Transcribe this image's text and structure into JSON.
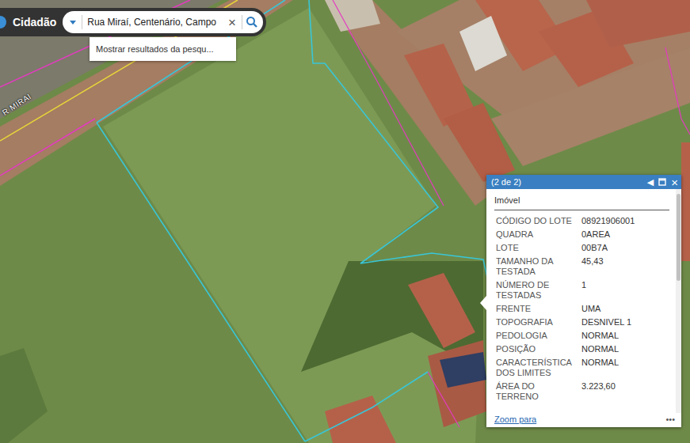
{
  "app": {
    "title": "Cidadão"
  },
  "search": {
    "value": "Rua Miraí, Centenário, Campo",
    "clear": "×",
    "suggestion": "Mostrar resultados da pesqu..."
  },
  "map": {
    "street_label": "R MIRAI"
  },
  "popup": {
    "pager": "(2 de 2)",
    "prev": "◀",
    "close": "×",
    "title": "Imóvel",
    "fields": [
      {
        "label": "CÓDIGO DO LOTE",
        "value": "08921906001"
      },
      {
        "label": "QUADRA",
        "value": "0AREA"
      },
      {
        "label": "LOTE",
        "value": "00B7A"
      },
      {
        "label": "TAMANHO DA TESTADA",
        "value": "45,43"
      },
      {
        "label": "NÚMERO DE TESTADAS",
        "value": "1"
      },
      {
        "label": "FRENTE",
        "value": "UMA"
      },
      {
        "label": "TOPOGRAFIA",
        "value": "DESNIVEL 1"
      },
      {
        "label": "PEDOLOGIA",
        "value": "NORMAL"
      },
      {
        "label": "POSIÇÃO",
        "value": "NORMAL"
      },
      {
        "label": "CARACTERÍSTICA DOS LIMITES",
        "value": "NORMAL"
      },
      {
        "label": "ÁREA DO TERRENO",
        "value": "3.223,60"
      }
    ],
    "zoom_link": "Zoom para",
    "more": "•••"
  }
}
